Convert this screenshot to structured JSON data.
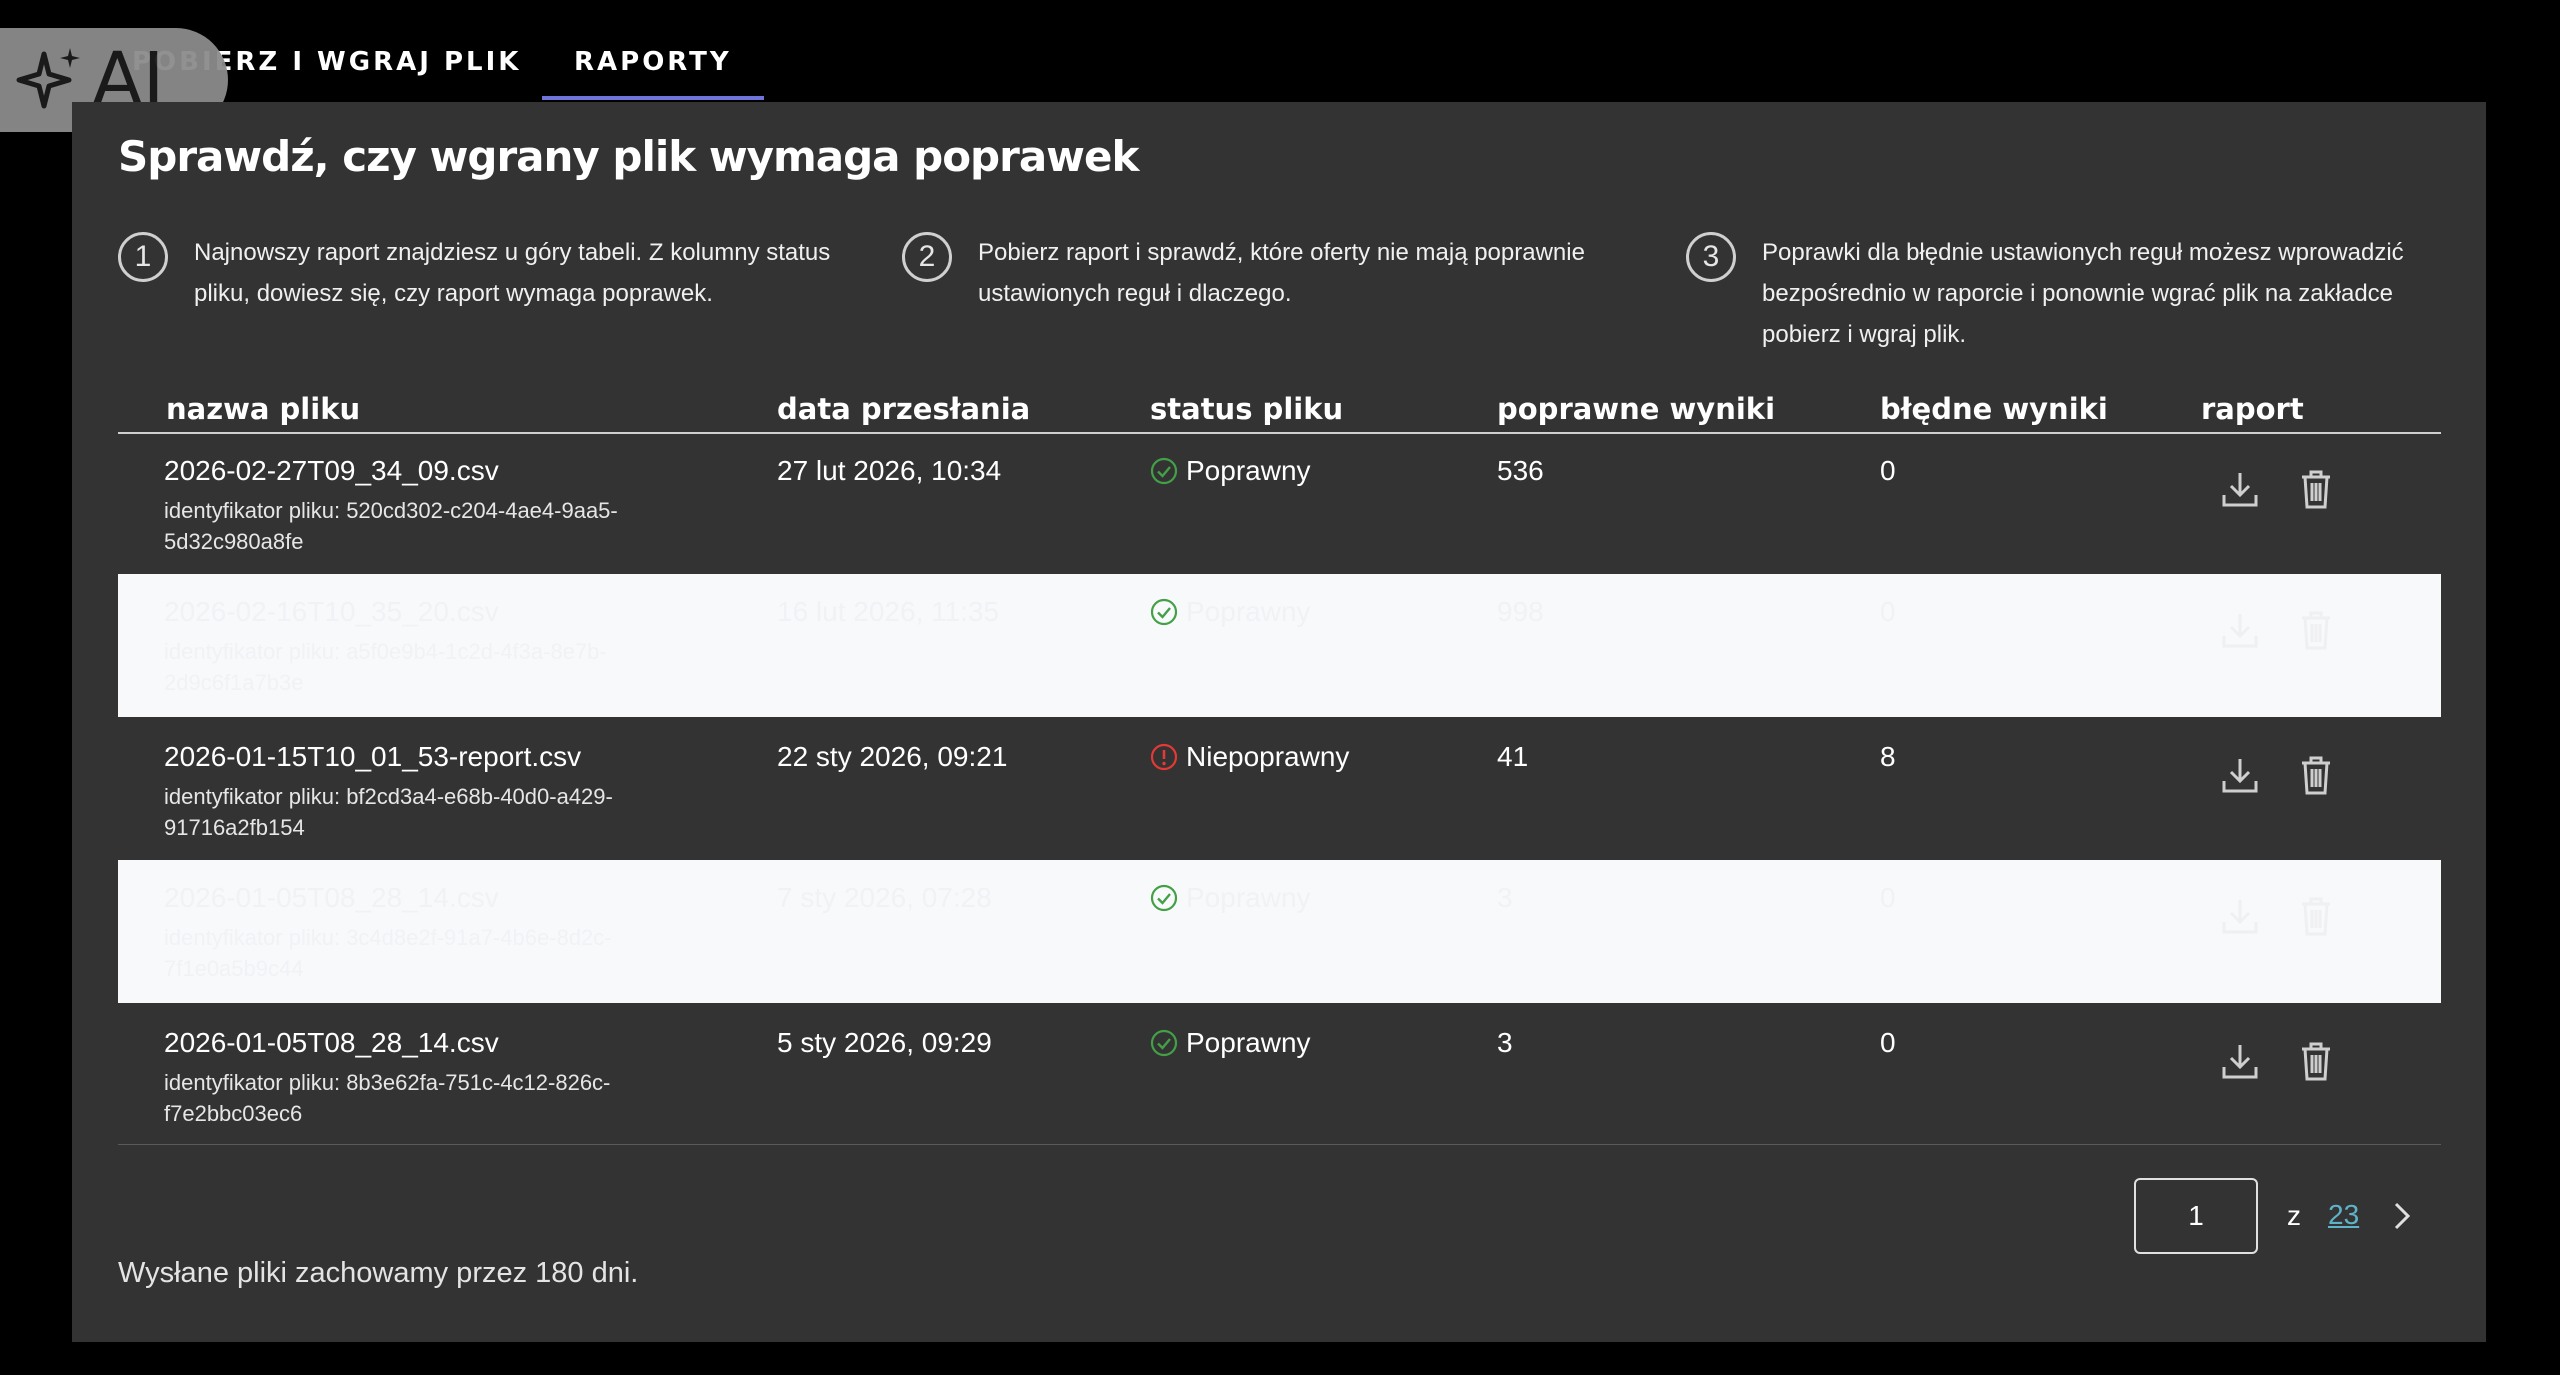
{
  "tabs": [
    {
      "label": "POBIERZ I WGRAJ PLIK"
    },
    {
      "label": "RAPORTY",
      "active": true
    }
  ],
  "ai_badge": {
    "label": "AI"
  },
  "main": {
    "title": "Sprawdź, czy wgrany plik wymaga poprawek",
    "steps": [
      {
        "num": "1",
        "text": "Najnowszy raport znajdziesz u góry tabeli. Z kolumny status pliku, dowiesz się, czy raport wymaga poprawek."
      },
      {
        "num": "2",
        "text": "Pobierz raport i sprawdź, które oferty nie mają poprawnie ustawionych reguł i dlaczego."
      },
      {
        "num": "3",
        "text": "Poprawki dla błędnie ustawionych reguł możesz wprowadzić bezpośrednio w raporcie i ponownie wgrać plik na zakładce pobierz i wgraj plik."
      }
    ]
  },
  "table": {
    "headers": {
      "name": "nazwa pliku",
      "date": "data przesłania",
      "status": "status pliku",
      "correct": "poprawne wyniki",
      "errors": "błędne wyniki",
      "report": "raport"
    },
    "rows": [
      {
        "file": "2026-02-27T09_34_09.csv",
        "id": "identyfikator pliku: 520cd302-c204-4ae4-9aa5-5d32c980a8fe",
        "date": "27 lut 2026, 10:34",
        "status": "Poprawny",
        "status_type": "ok",
        "correct": "536",
        "errors": "0",
        "highlighted": false
      },
      {
        "file": "2026-02-16T10_35_20.csv",
        "id": "identyfikator pliku: a5f0e9b4-1c2d-4f3a-8e7b-2d9c6f1a7b3e",
        "date": "16 lut 2026, 11:35",
        "status": "Poprawny",
        "status_type": "ok",
        "correct": "998",
        "errors": "0",
        "highlighted": true
      },
      {
        "file": "2026-01-15T10_01_53-report.csv",
        "id": "identyfikator pliku: bf2cd3a4-e68b-40d0-a429-91716a2fb154",
        "date": "22 sty 2026, 09:21",
        "status": "Niepoprawny",
        "status_type": "error",
        "correct": "41",
        "errors": "8",
        "highlighted": false
      },
      {
        "file": "2026-01-05T08_28_14.csv",
        "id": "identyfikator pliku: 3c4d8e2f-91a7-4b6e-8d2c-7f1e0a5b9c44",
        "date": "7 sty 2026, 07:28",
        "status": "Poprawny",
        "status_type": "ok",
        "correct": "3",
        "errors": "0",
        "highlighted": true
      },
      {
        "file": "2026-01-05T08_28_14.csv",
        "id": "identyfikator pliku: 8b3e62fa-751c-4c12-826c-f7e2bbc03ec6",
        "date": "5 sty 2026, 09:29",
        "status": "Poprawny",
        "status_type": "ok",
        "correct": "3",
        "errors": "0",
        "highlighted": false
      }
    ]
  },
  "pager": {
    "current": "1",
    "of": "z",
    "total": "23"
  },
  "footer": {
    "note": "Wysłane pliki zachowamy przez 180 dni."
  },
  "colors": {
    "ok": "#43a047",
    "error": "#e53935",
    "tab_underline": "#6f74d8",
    "link": "#5fb3c8"
  }
}
